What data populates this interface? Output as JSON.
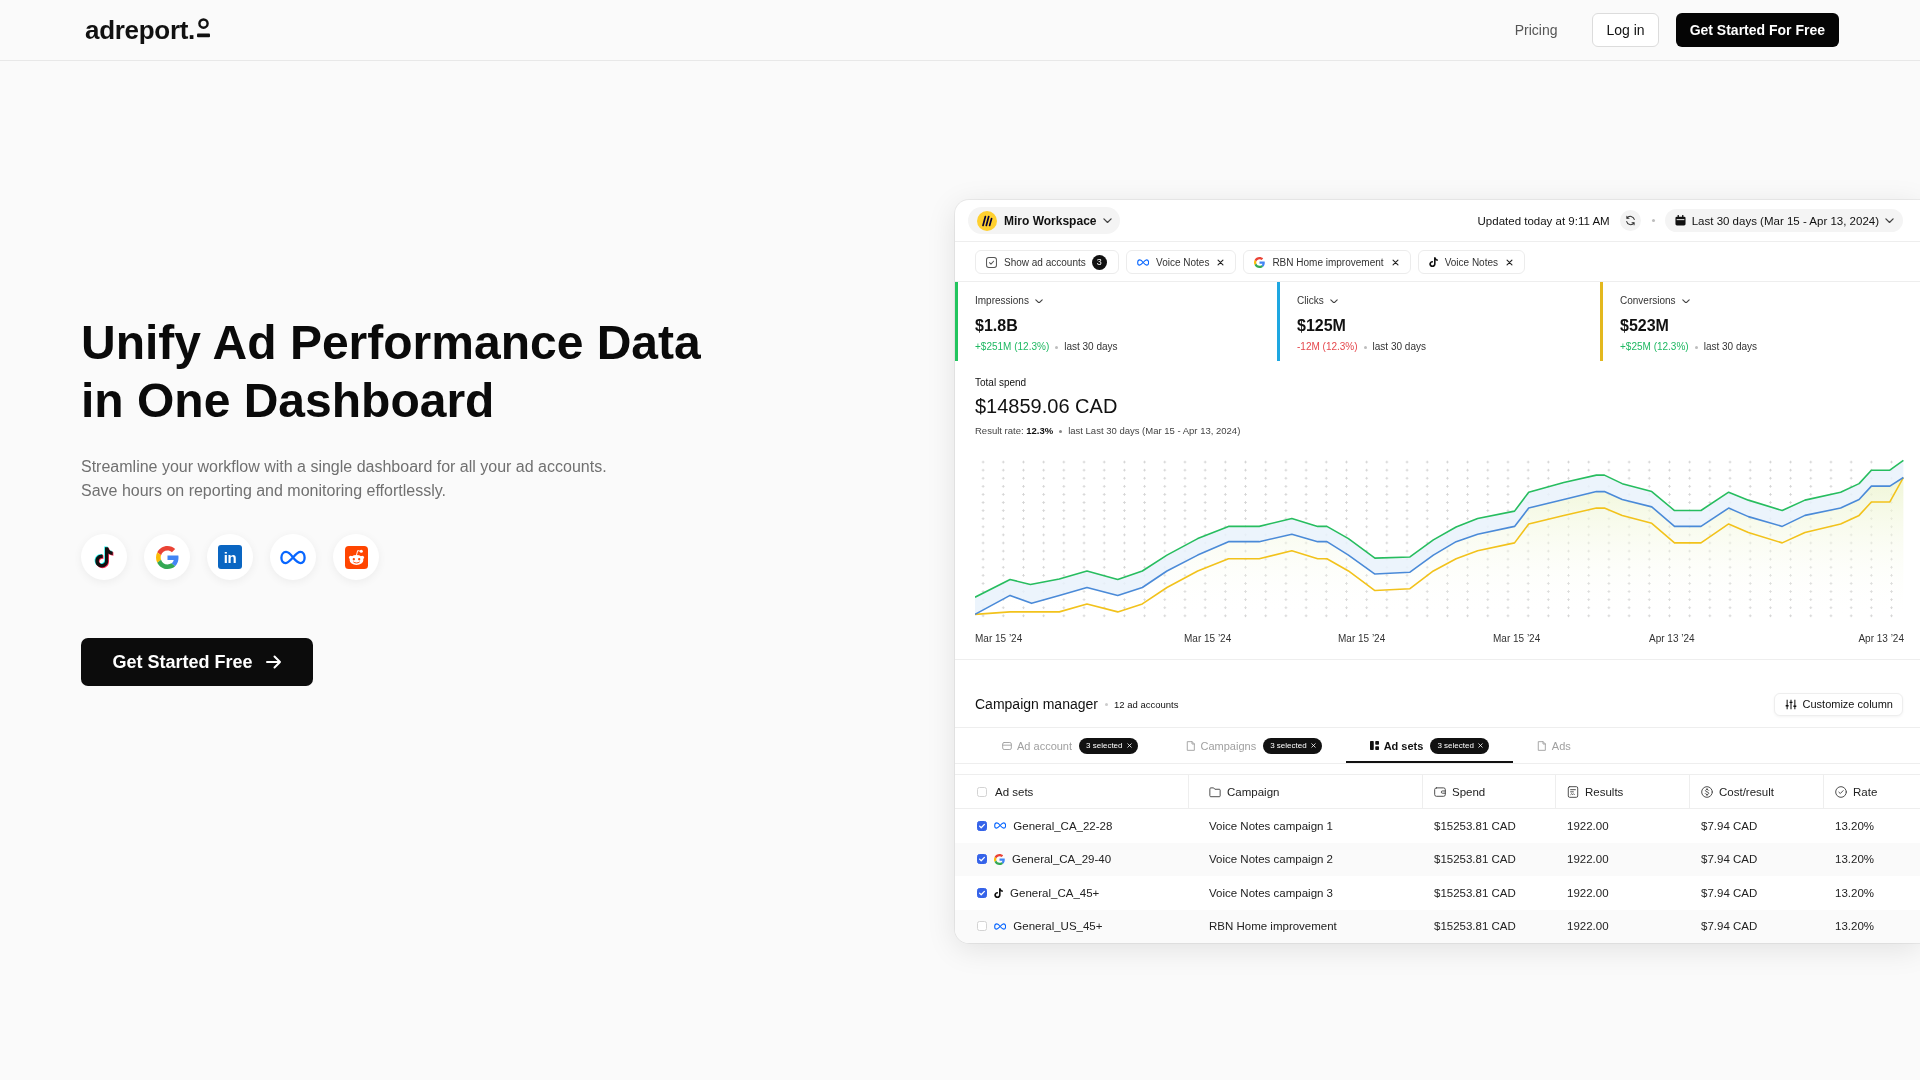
{
  "header": {
    "logo": "adreport.",
    "nav": [
      {
        "kind": "link",
        "label": "Pricing"
      },
      {
        "kind": "login",
        "label": "Log in"
      },
      {
        "kind": "signup",
        "label": "Get Started For Free"
      }
    ]
  },
  "hero": {
    "title": "Unify Ad Performance Data in One Dashboard",
    "subtitle": "Streamline your workflow with a single dashboard for all your ad accounts. Save hours on reporting and monitoring effortlessly.",
    "platforms": [
      {
        "kind": "tiktok"
      },
      {
        "kind": "google"
      },
      {
        "kind": "linkedin",
        "mark": "in"
      },
      {
        "kind": "meta"
      },
      {
        "kind": "reddit"
      }
    ],
    "cta": "Get Started Free"
  },
  "dashboard": {
    "workspace": "Miro Workspace",
    "updated": "Updated today at 9:11 AM",
    "date_range": "Last 30 days (Mar 15 - Apr 13, 2024)",
    "filters": [
      {
        "kind": "accounts",
        "label": "Show ad accounts",
        "count": "3"
      },
      {
        "kind": "meta",
        "label": "Voice Notes"
      },
      {
        "kind": "google",
        "label": "RBN Home improvement"
      },
      {
        "kind": "tiktok",
        "label": "Voice Notes"
      }
    ],
    "metrics": [
      {
        "label": "Impressions",
        "value": "$1.8B",
        "change": "+$251M (12.3%)",
        "positive": true,
        "period": "last 30 days",
        "color": "#22c55e"
      },
      {
        "label": "Clicks",
        "value": "$125M",
        "change": "-12M (12.3%)",
        "positive": false,
        "period": "last 30 days",
        "color": "#1ea7e1"
      },
      {
        "label": "Conversions",
        "value": "$523M",
        "change": "+$25M (12.3%)",
        "positive": true,
        "period": "last 30 days",
        "color": "#e3b81e"
      }
    ],
    "total_spend": {
      "label": "Total spend",
      "value": "$14859.06 CAD",
      "rate": "Result rate: **12.3%**",
      "period": "last Last 30 days (Mar 15 - Apr 13, 2024)"
    },
    "chart": {
      "x_labels": [
        "Mar 15 ’24",
        "Mar 15 ’24",
        "Mar 15 ’24",
        "Mar 15 ’24",
        "Apr 13 ’24",
        "Apr 13 ’24"
      ]
    },
    "campaign_manager": {
      "title": "Campaign manager",
      "count": "12 ad accounts",
      "customize": "Customize column",
      "tabs": [
        {
          "label": "Ad account",
          "badge": "3 selected",
          "selected": false
        },
        {
          "label": "Campaigns",
          "badge": "3 selected",
          "selected": false
        },
        {
          "label": "Ad sets",
          "badge": "3 selected",
          "selected": true
        },
        {
          "label": "Ads",
          "selected": false
        }
      ],
      "table": {
        "select_all": {
          "checked": false
        },
        "columns": [
          "Ad sets",
          "Campaign",
          "Spend",
          "Results",
          "Cost/result",
          "Rate"
        ],
        "rows": [
          {
            "kind": "meta",
            "checked": true,
            "ad_set": "General_CA_22-28",
            "campaign": "Voice Notes campaign 1",
            "spend": "$15253.81 CAD",
            "results": "1922.00",
            "cost_per_result": "$7.94 CAD",
            "rate": "13.20%"
          },
          {
            "kind": "google",
            "checked": true,
            "ad_set": "General_CA_29-40",
            "campaign": "Voice Notes campaign 2",
            "spend": "$15253.81 CAD",
            "results": "1922.00",
            "cost_per_result": "$7.94 CAD",
            "rate": "13.20%"
          },
          {
            "kind": "tiktok",
            "checked": true,
            "ad_set": "General_CA_45+",
            "campaign": "Voice Notes campaign 3",
            "spend": "$15253.81 CAD",
            "results": "1922.00",
            "cost_per_result": "$7.94 CAD",
            "rate": "13.20%"
          },
          {
            "kind": "meta",
            "checked": false,
            "ad_set": "General_US_45+",
            "campaign": "RBN Home improvement",
            "spend": "$15253.81 CAD",
            "results": "1922.00",
            "cost_per_result": "$7.94 CAD",
            "rate": "13.20%"
          }
        ]
      }
    }
  }
}
